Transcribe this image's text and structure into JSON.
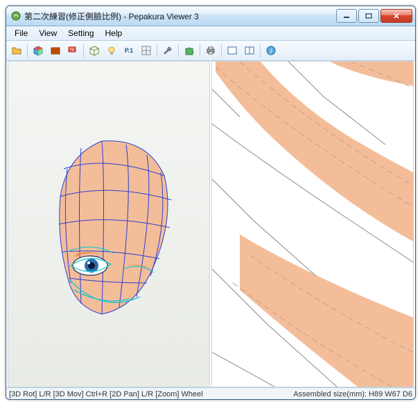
{
  "window": {
    "title": "第二次練習(修正側臉比例) - Pepakura Viewer 3"
  },
  "menu": {
    "file": "File",
    "view": "View",
    "setting": "Setting",
    "help": "Help"
  },
  "toolbar_icons": {
    "open": "open-folder-icon",
    "cube_color": "color-cube-icon",
    "texture": "texture-icon",
    "label": "label-icon",
    "cube_white": "white-cube-icon",
    "bulb": "bulb-icon",
    "p1": "page-p1-icon",
    "compass": "compass-icon",
    "wrench": "wrench-icon",
    "puzzle": "puzzle-icon",
    "print": "print-icon",
    "window1": "window-icon",
    "window2": "dual-window-icon",
    "info": "info-icon"
  },
  "toolbar_labels": {
    "p1": "P.1"
  },
  "status": {
    "left": "[3D Rot] L/R [3D Mov] Ctrl+R [2D Pan] L/R [Zoom] Wheel",
    "right": "Assembled size(mm): H89 W67 D6"
  },
  "colors": {
    "skin": "#f4bd9a",
    "wire": "#2b3ed0",
    "eye_outline": "#16c6c9",
    "iris": "#2a6fb3"
  }
}
